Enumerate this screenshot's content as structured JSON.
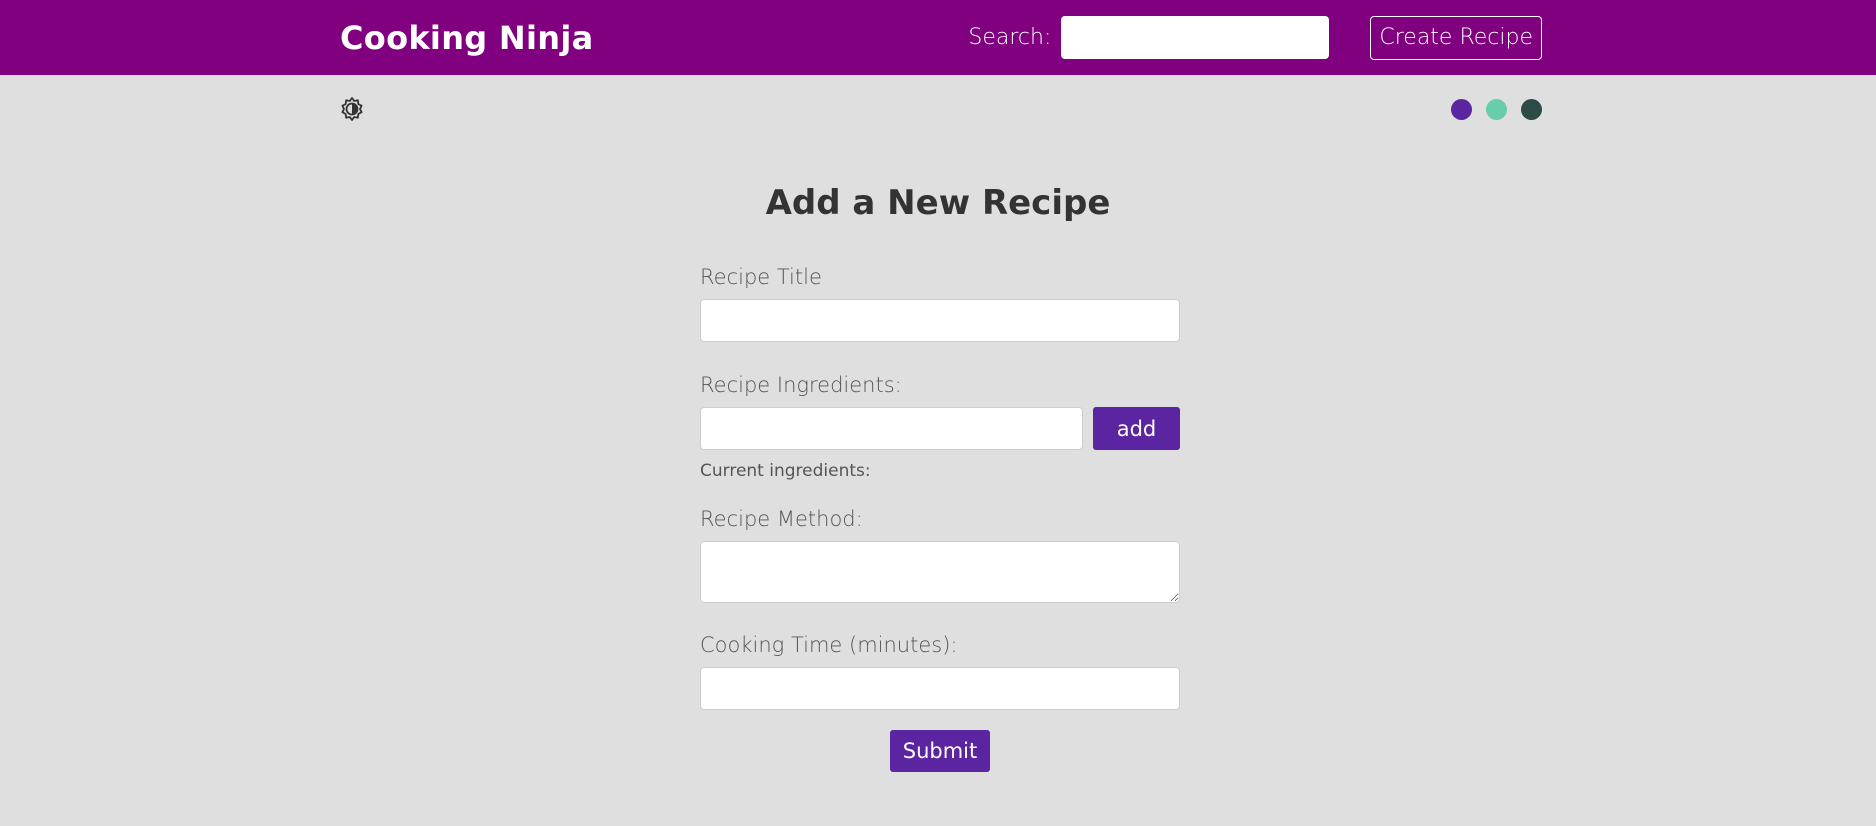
{
  "navbar": {
    "brand": "Cooking Ninja",
    "search_label": "Search:",
    "search_value": "",
    "create_button": "Create Recipe",
    "background_color": "#800080"
  },
  "theme": {
    "mode_icon": "brightness-contrast-icon",
    "swatches": [
      {
        "name": "purple",
        "color": "#5b24a0"
      },
      {
        "name": "teal",
        "color": "#67cdaa"
      },
      {
        "name": "dark-slate",
        "color": "#2c4a46"
      }
    ]
  },
  "form": {
    "heading": "Add a New Recipe",
    "title_label": "Recipe Title",
    "title_value": "",
    "ingredients_label": "Recipe Ingredients:",
    "ingredient_value": "",
    "add_button": "add",
    "current_ingredients_label": "Current ingredients:",
    "method_label": "Recipe Method:",
    "method_value": "",
    "cooking_time_label": "Cooking Time (minutes):",
    "cooking_time_value": "",
    "submit_button": "Submit"
  }
}
